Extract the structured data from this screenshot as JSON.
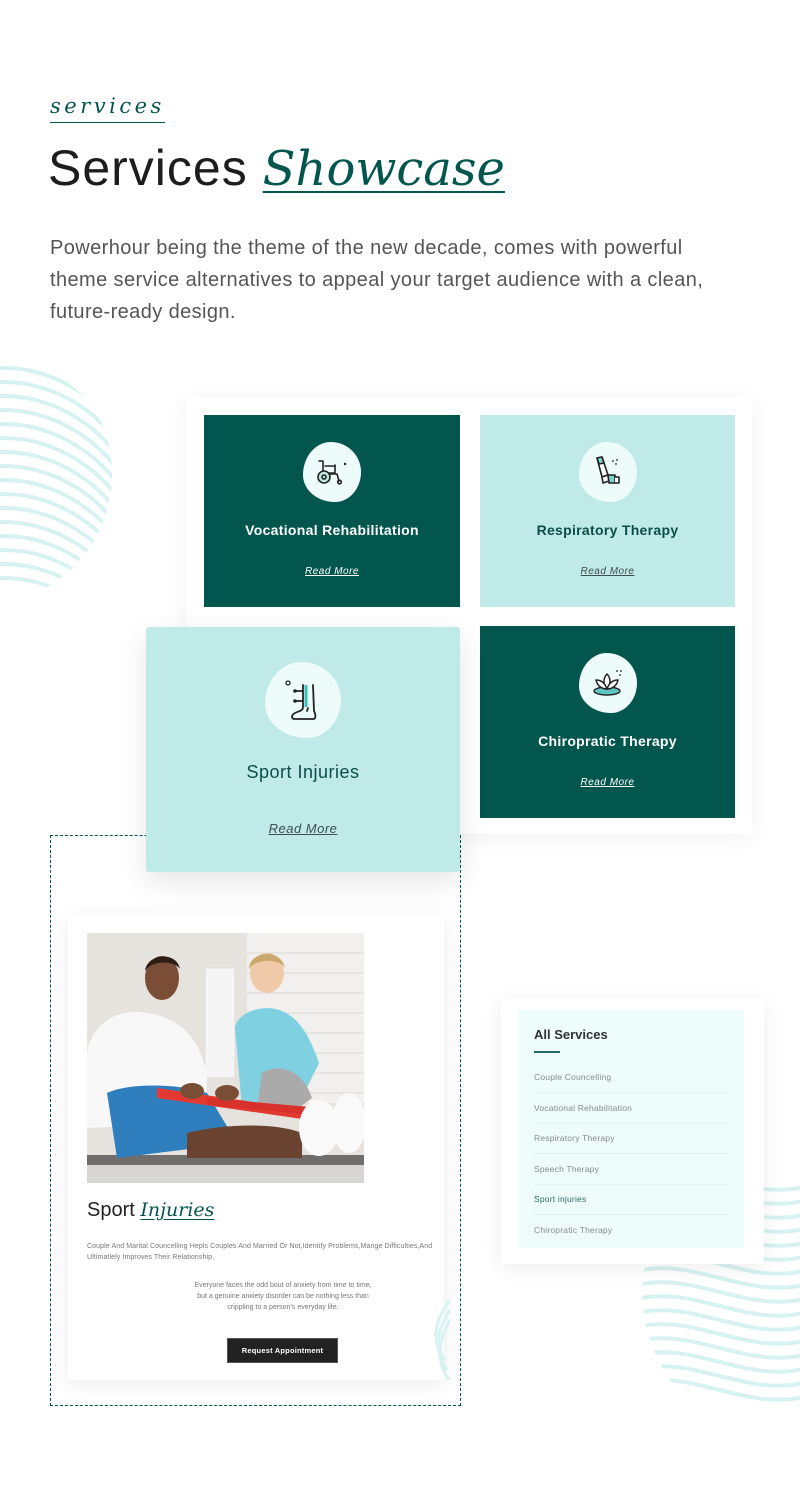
{
  "header": {
    "eyebrow": "services",
    "title_plain": "Services",
    "title_accent": "Showcase",
    "lead": "Powerhour being the theme of the new decade, comes with powerful theme service alternatives to appeal your target audience with a clean, future-ready design."
  },
  "colors": {
    "brand_dark": "#03564e",
    "brand_light": "#bfeae7",
    "icon_bg": "#edfbfb",
    "list_bg": "#effcfc",
    "button_bg": "#222222"
  },
  "service_cards": [
    {
      "name": "Vocational Rehabilitation",
      "link": "Read More",
      "icon": "wheelchair-icon",
      "theme": "dark"
    },
    {
      "name": "Respiratory Therapy",
      "link": "Read More",
      "icon": "inhaler-icon",
      "theme": "light"
    },
    {
      "name": "Sport Injuries",
      "link": "Read More",
      "icon": "ankle-brace-icon",
      "theme": "light"
    },
    {
      "name": "Chiropratic Therapy",
      "link": "Read More",
      "icon": "lotus-icon",
      "theme": "dark"
    }
  ],
  "detail": {
    "image_alt": "physiotherapist-with-patient-photo",
    "title_plain": "Sport",
    "title_accent": "Injuries",
    "description": "Couple And Marital Councelling Hepls Couples And Married Or Not,Identify Problems,Mange Difficulties,And Ultimatlely Improves Their Relationship.",
    "quote_lines": [
      "Everyone faces the odd bout of anxiety from time to time,",
      "but a genuine anxiety disorder can be nothing less than",
      "crippling to a person’s everyday life."
    ],
    "button_label": "Request Appointment"
  },
  "all_services": {
    "title": "All Services",
    "items": [
      {
        "label": "Couple Councelling",
        "active": false
      },
      {
        "label": "Vocational Rehabilitation",
        "active": false
      },
      {
        "label": "Respiratory Therapy",
        "active": false
      },
      {
        "label": "Speech Therapy",
        "active": false
      },
      {
        "label": "Sport injuries",
        "active": true
      },
      {
        "label": "Chiropratic Therapy",
        "active": false
      }
    ]
  }
}
